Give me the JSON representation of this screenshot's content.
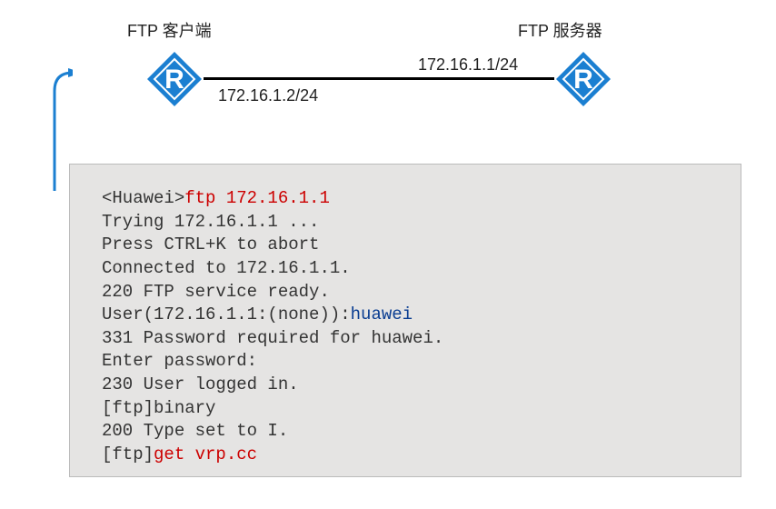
{
  "topology": {
    "client_label": "FTP 客户端",
    "server_label": "FTP 服务器",
    "client_ip": "172.16.1.2/24",
    "server_ip": "172.16.1.1/24",
    "router_letter": "R"
  },
  "terminal": {
    "lines": [
      {
        "prompt": "<Huawei>",
        "cmd_red": "ftp 172.16.1.1"
      },
      {
        "text": "Trying 172.16.1.1 ..."
      },
      {
        "text": "Press CTRL+K to abort"
      },
      {
        "text": "Connected to 172.16.1.1."
      },
      {
        "text": "220 FTP service ready."
      },
      {
        "prefix": "User(172.16.1.1:(none)):",
        "user_blue": "huawei"
      },
      {
        "text": "331 Password required for huawei."
      },
      {
        "text": "Enter password:"
      },
      {
        "text": "230 User logged in."
      },
      {
        "prompt": "[ftp]",
        "rest": "binary"
      },
      {
        "text": "200 Type set to I."
      },
      {
        "prompt": "[ftp]",
        "cmd_red": "get vrp.cc"
      }
    ]
  },
  "colors": {
    "router_blue": "#1b7fd1",
    "cmd_red": "#cc0000",
    "user_blue": "#0a3d91",
    "terminal_bg": "#e5e4e3"
  }
}
